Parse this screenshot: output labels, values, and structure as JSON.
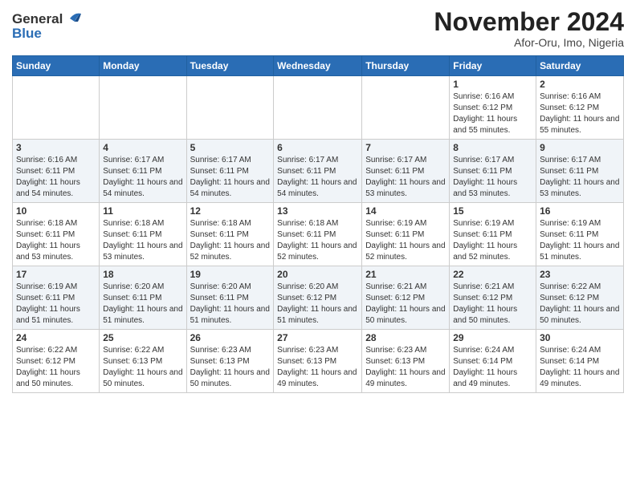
{
  "header": {
    "logo_general": "General",
    "logo_blue": "Blue",
    "month": "November 2024",
    "location": "Afor-Oru, Imo, Nigeria"
  },
  "weekdays": [
    "Sunday",
    "Monday",
    "Tuesday",
    "Wednesday",
    "Thursday",
    "Friday",
    "Saturday"
  ],
  "weeks": [
    [
      {
        "day": "",
        "info": ""
      },
      {
        "day": "",
        "info": ""
      },
      {
        "day": "",
        "info": ""
      },
      {
        "day": "",
        "info": ""
      },
      {
        "day": "",
        "info": ""
      },
      {
        "day": "1",
        "info": "Sunrise: 6:16 AM\nSunset: 6:12 PM\nDaylight: 11 hours and 55 minutes."
      },
      {
        "day": "2",
        "info": "Sunrise: 6:16 AM\nSunset: 6:12 PM\nDaylight: 11 hours and 55 minutes."
      }
    ],
    [
      {
        "day": "3",
        "info": "Sunrise: 6:16 AM\nSunset: 6:11 PM\nDaylight: 11 hours and 54 minutes."
      },
      {
        "day": "4",
        "info": "Sunrise: 6:17 AM\nSunset: 6:11 PM\nDaylight: 11 hours and 54 minutes."
      },
      {
        "day": "5",
        "info": "Sunrise: 6:17 AM\nSunset: 6:11 PM\nDaylight: 11 hours and 54 minutes."
      },
      {
        "day": "6",
        "info": "Sunrise: 6:17 AM\nSunset: 6:11 PM\nDaylight: 11 hours and 54 minutes."
      },
      {
        "day": "7",
        "info": "Sunrise: 6:17 AM\nSunset: 6:11 PM\nDaylight: 11 hours and 53 minutes."
      },
      {
        "day": "8",
        "info": "Sunrise: 6:17 AM\nSunset: 6:11 PM\nDaylight: 11 hours and 53 minutes."
      },
      {
        "day": "9",
        "info": "Sunrise: 6:17 AM\nSunset: 6:11 PM\nDaylight: 11 hours and 53 minutes."
      }
    ],
    [
      {
        "day": "10",
        "info": "Sunrise: 6:18 AM\nSunset: 6:11 PM\nDaylight: 11 hours and 53 minutes."
      },
      {
        "day": "11",
        "info": "Sunrise: 6:18 AM\nSunset: 6:11 PM\nDaylight: 11 hours and 53 minutes."
      },
      {
        "day": "12",
        "info": "Sunrise: 6:18 AM\nSunset: 6:11 PM\nDaylight: 11 hours and 52 minutes."
      },
      {
        "day": "13",
        "info": "Sunrise: 6:18 AM\nSunset: 6:11 PM\nDaylight: 11 hours and 52 minutes."
      },
      {
        "day": "14",
        "info": "Sunrise: 6:19 AM\nSunset: 6:11 PM\nDaylight: 11 hours and 52 minutes."
      },
      {
        "day": "15",
        "info": "Sunrise: 6:19 AM\nSunset: 6:11 PM\nDaylight: 11 hours and 52 minutes."
      },
      {
        "day": "16",
        "info": "Sunrise: 6:19 AM\nSunset: 6:11 PM\nDaylight: 11 hours and 51 minutes."
      }
    ],
    [
      {
        "day": "17",
        "info": "Sunrise: 6:19 AM\nSunset: 6:11 PM\nDaylight: 11 hours and 51 minutes."
      },
      {
        "day": "18",
        "info": "Sunrise: 6:20 AM\nSunset: 6:11 PM\nDaylight: 11 hours and 51 minutes."
      },
      {
        "day": "19",
        "info": "Sunrise: 6:20 AM\nSunset: 6:11 PM\nDaylight: 11 hours and 51 minutes."
      },
      {
        "day": "20",
        "info": "Sunrise: 6:20 AM\nSunset: 6:12 PM\nDaylight: 11 hours and 51 minutes."
      },
      {
        "day": "21",
        "info": "Sunrise: 6:21 AM\nSunset: 6:12 PM\nDaylight: 11 hours and 50 minutes."
      },
      {
        "day": "22",
        "info": "Sunrise: 6:21 AM\nSunset: 6:12 PM\nDaylight: 11 hours and 50 minutes."
      },
      {
        "day": "23",
        "info": "Sunrise: 6:22 AM\nSunset: 6:12 PM\nDaylight: 11 hours and 50 minutes."
      }
    ],
    [
      {
        "day": "24",
        "info": "Sunrise: 6:22 AM\nSunset: 6:12 PM\nDaylight: 11 hours and 50 minutes."
      },
      {
        "day": "25",
        "info": "Sunrise: 6:22 AM\nSunset: 6:13 PM\nDaylight: 11 hours and 50 minutes."
      },
      {
        "day": "26",
        "info": "Sunrise: 6:23 AM\nSunset: 6:13 PM\nDaylight: 11 hours and 50 minutes."
      },
      {
        "day": "27",
        "info": "Sunrise: 6:23 AM\nSunset: 6:13 PM\nDaylight: 11 hours and 49 minutes."
      },
      {
        "day": "28",
        "info": "Sunrise: 6:23 AM\nSunset: 6:13 PM\nDaylight: 11 hours and 49 minutes."
      },
      {
        "day": "29",
        "info": "Sunrise: 6:24 AM\nSunset: 6:14 PM\nDaylight: 11 hours and 49 minutes."
      },
      {
        "day": "30",
        "info": "Sunrise: 6:24 AM\nSunset: 6:14 PM\nDaylight: 11 hours and 49 minutes."
      }
    ]
  ]
}
